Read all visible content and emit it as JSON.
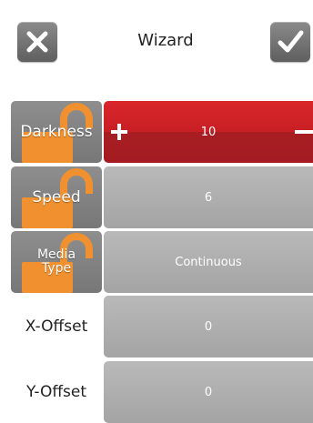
{
  "header": {
    "title": "Wizard",
    "close_icon": "close-x-icon",
    "confirm_icon": "checkmark-icon"
  },
  "rows": [
    {
      "label": "Darkness",
      "value": "10",
      "locked": true,
      "active": true,
      "controls": {
        "plus": "+",
        "minus": "−"
      }
    },
    {
      "label": "Speed",
      "value": "6",
      "locked": true,
      "active": false
    },
    {
      "label": "Media\nType",
      "value": "Continuous",
      "locked": true,
      "active": false
    },
    {
      "label": "X-Offset",
      "value": "0",
      "locked": false,
      "active": false
    },
    {
      "label": "Y-Offset",
      "value": "0",
      "locked": false,
      "active": false
    }
  ],
  "colors": {
    "active": "#c81f24",
    "lock": "#f0902f",
    "button": "#777777"
  }
}
